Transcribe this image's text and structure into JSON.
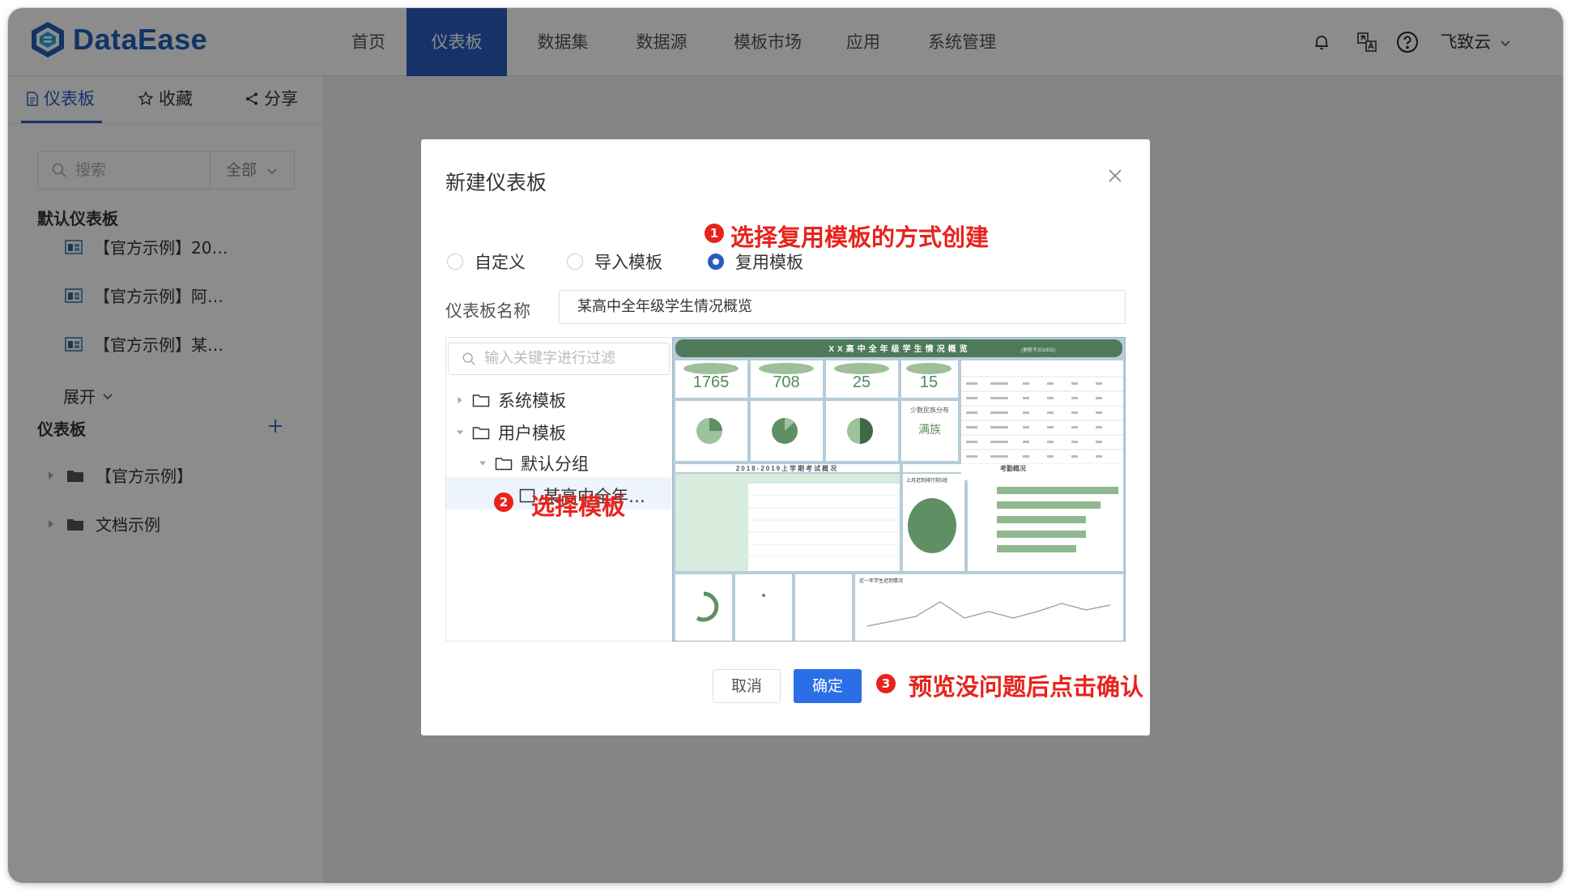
{
  "app": {
    "logo_text": "DataEase"
  },
  "nav": {
    "items": [
      "首页",
      "仪表板",
      "数据集",
      "数据源",
      "模板市场",
      "应用",
      "系统管理"
    ],
    "active_index": 1,
    "user": "飞致云"
  },
  "sidebar": {
    "tabs": [
      "仪表板",
      "收藏",
      "分享"
    ],
    "search_placeholder": "搜索",
    "search_scope": "全部",
    "default_section": "默认仪表板",
    "default_items": [
      "【官方示例】20…",
      "【官方示例】阿…",
      "【官方示例】某…"
    ],
    "expand_label": "展开",
    "dash_section": "仪表板",
    "folders": [
      "【官方示例】",
      "文档示例"
    ]
  },
  "dialog": {
    "title": "新建仪表板",
    "radios": [
      "自定义",
      "导入模板",
      "复用模板"
    ],
    "selected_radio": 2,
    "name_label": "仪表板名称",
    "name_value": "某高中全年级学生情况概览",
    "tree_filter_placeholder": "输入关键字进行过滤",
    "tree": {
      "system_templates": "系统模板",
      "user_templates": "用户模板",
      "default_group": "默认分组",
      "selected_template": "某高中全年…"
    },
    "cancel_label": "取消",
    "confirm_label": "确定"
  },
  "preview": {
    "title": "XX高中全年级学生情况概览",
    "title_suffix": "(更新于201902)",
    "kpis": [
      "1765",
      "708",
      "25",
      "15"
    ],
    "minority_label": "少数民族分布",
    "minority_value": "满族",
    "section_left": "2018-2019上学期考试概况",
    "section_right": "考勤概况",
    "pie_caption": "上月迟到排行前5班",
    "line_caption": "近一年学生迟到情况"
  },
  "annotations": {
    "step1_num": "1",
    "step1_text": "选择复用模板的方式创建",
    "step2_num": "2",
    "step2_text": "选择模板",
    "step3_num": "3",
    "step3_text": "预览没问题后点击确认"
  },
  "colors": {
    "primary": "#2a5cc0",
    "annotation": "#e8231c",
    "preview_green": "#5f9063"
  }
}
